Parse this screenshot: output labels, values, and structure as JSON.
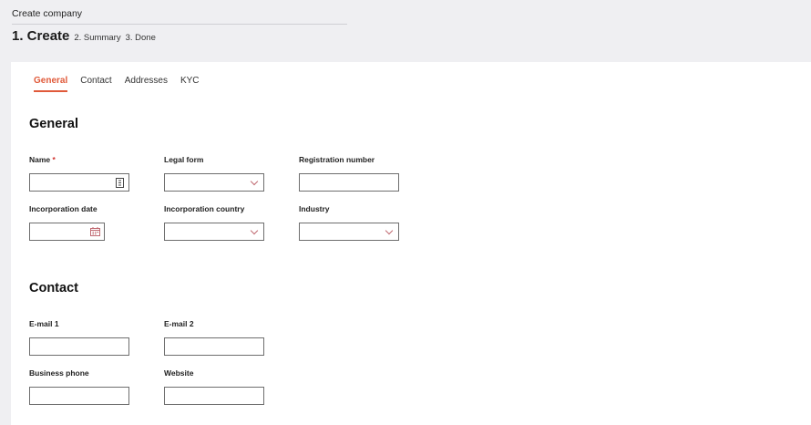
{
  "header": {
    "title": "Create company",
    "steps": {
      "current": "1. Create",
      "next": "2. Summary",
      "last": "3. Done"
    }
  },
  "tabs": [
    {
      "label": "General",
      "active": true
    },
    {
      "label": "Contact",
      "active": false
    },
    {
      "label": "Addresses",
      "active": false
    },
    {
      "label": "KYC",
      "active": false
    }
  ],
  "general": {
    "title": "General",
    "name_label": "Name",
    "required_mark": "*",
    "legal_form_label": "Legal form",
    "registration_number_label": "Registration number",
    "incorporation_date_label": "Incorporation date",
    "incorporation_country_label": "Incorporation country",
    "industry_label": "Industry"
  },
  "contact": {
    "title": "Contact",
    "email1_label": "E-mail 1",
    "email2_label": "E-mail 2",
    "business_phone_label": "Business phone",
    "website_label": "Website"
  },
  "colors": {
    "accent": "#e05a3a",
    "background": "#efeff2",
    "panel": "#ffffff",
    "border": "#6e6e6e",
    "required": "#d0312d"
  },
  "icons": {
    "name_field": "contact-card-icon",
    "date_field": "calendar-icon",
    "dropdown": "chevron-down-icon"
  }
}
